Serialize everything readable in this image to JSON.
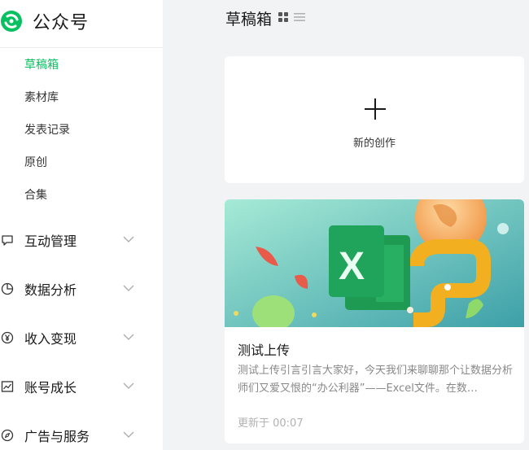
{
  "app": {
    "name": "公众号"
  },
  "sidebar": {
    "sub_items": [
      {
        "label": "草稿箱",
        "active": true
      },
      {
        "label": "素材库",
        "active": false
      },
      {
        "label": "发表记录",
        "active": false
      },
      {
        "label": "原创",
        "active": false
      },
      {
        "label": "合集",
        "active": false
      }
    ],
    "groups": [
      {
        "label": "互动管理",
        "icon": "chat-bubble-icon"
      },
      {
        "label": "数据分析",
        "icon": "pie-chart-icon"
      },
      {
        "label": "收入变现",
        "icon": "yen-icon"
      },
      {
        "label": "账号成长",
        "icon": "trend-chart-icon"
      },
      {
        "label": "广告与服务",
        "icon": "compass-icon"
      }
    ]
  },
  "main": {
    "title": "草稿箱",
    "new_card": {
      "label": "新的创作"
    },
    "article": {
      "title": "测试上传",
      "digest": "测试上传引言引言大家好，今天我们来聊聊那个让数据分析师们又爱又恨的“办公利器”——Excel文件。在数…",
      "updated": "更新于 00:07"
    }
  },
  "colors": {
    "accent": "#07c160",
    "background": "#f2f3f5"
  }
}
